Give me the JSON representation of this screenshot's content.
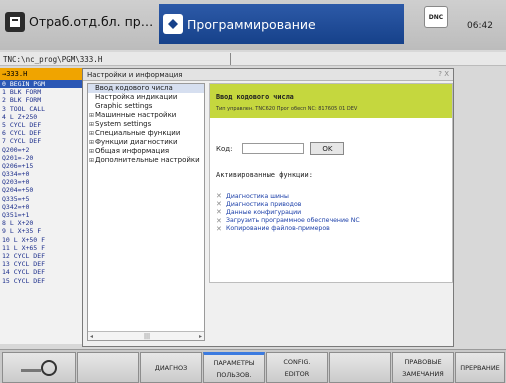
{
  "header": {
    "mode_manual": "Отраб.отд.бл. пр…",
    "mode_program": "Программирование",
    "dnc": "DNC",
    "clock": "06:42"
  },
  "path": "TNC:\\nc_prog\\PGM\\333.H",
  "program": {
    "filename": "→333.H",
    "lines": [
      "0  BEGIN PGM",
      "1  BLK FORM",
      "2  BLK FORM",
      "3  TOOL CALL",
      "4  L  Z+250",
      "5  CYCL DEF",
      "6  CYCL DEF",
      "7  CYCL DEF",
      "   Q200=+2",
      "   Q201=-20",
      "   Q206=+15",
      "   Q334=+0",
      "   Q203=+0",
      "   Q204=+50",
      "   Q335=+5",
      "   Q342=+0",
      "   Q351=+1",
      "8  L  X+20",
      "9  L  X+35 F",
      "10 L  X+50 F",
      "11 L  X+65 F",
      "12 CYCL DEF",
      "13 CYCL DEF",
      "14 CYCL DEF",
      "15 CYCL DEF"
    ]
  },
  "window": {
    "title": "Настройки и информация",
    "controls": "? X",
    "tree": [
      {
        "label": "Ввод кодового числа",
        "expand": ""
      },
      {
        "label": "Настройка индикации",
        "expand": ""
      },
      {
        "label": "Graphic settings",
        "expand": ""
      },
      {
        "label": "Машинные настройки",
        "expand": "⊞"
      },
      {
        "label": "System settings",
        "expand": "⊞"
      },
      {
        "label": "Специальные функции",
        "expand": "⊞"
      },
      {
        "label": "Функции диагностики",
        "expand": "⊞"
      },
      {
        "label": "Общая информация",
        "expand": "⊞"
      },
      {
        "label": "Дополнительные настройки",
        "expand": "⊞"
      }
    ],
    "content": {
      "title": "Ввод кодового числа",
      "subtitle": "Тип управлен.  TNC620 Прог обесп NC: 817605 01 DEV",
      "code_label": "Код:",
      "ok": "OK",
      "functions_title": "Активированные функции:",
      "functions": [
        "Диагностика шины",
        "Диагностика приводов",
        "Данные конфигурации",
        "Загрузить программное обеспечение NC",
        "Копирование файлов-примеров"
      ]
    }
  },
  "softkeys": [
    {
      "line1": "",
      "line2": ""
    },
    {
      "line1": "",
      "line2": ""
    },
    {
      "line1": "ДИАГНОЗ",
      "line2": ""
    },
    {
      "line1": "ПАРАМЕТРЫ",
      "line2": "ПОЛЬЗОВ."
    },
    {
      "line1": "CONFIG.",
      "line2": "EDITOR"
    },
    {
      "line1": "",
      "line2": ""
    },
    {
      "line1": "ПРАВОВЫЕ",
      "line2": "ЗАМЕЧАНИЯ"
    },
    {
      "line1": "ПРЕРВАНИЕ",
      "line2": ""
    }
  ]
}
